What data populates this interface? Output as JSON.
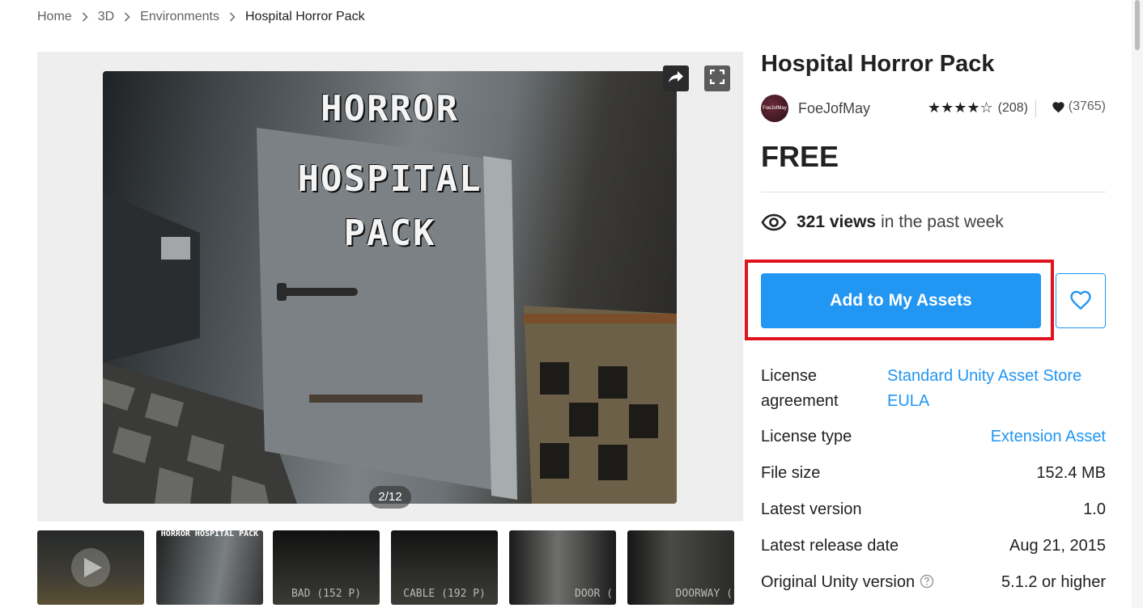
{
  "breadcrumb": {
    "items": [
      "Home",
      "3D",
      "Environments",
      "Hospital Horror Pack"
    ]
  },
  "gallery": {
    "main_title_lines": [
      "HORROR",
      "HOSPITAL",
      "PACK"
    ],
    "counter": "2/12",
    "share_icon": "share-icon",
    "fullscreen_icon": "fullscreen-icon",
    "thumbnails": [
      {
        "label": "",
        "title": "",
        "icon": "play-icon"
      },
      {
        "label": "",
        "title": "HORROR HOSPITAL PACK"
      },
      {
        "label": "BAD (152 P)",
        "title": ""
      },
      {
        "label": "CABLE (192 P)",
        "title": ""
      },
      {
        "label": "DOOR (",
        "title": ""
      },
      {
        "label": "DOORWAY (",
        "title": ""
      }
    ]
  },
  "product": {
    "title": "Hospital Horror Pack",
    "publisher": "FoeJofMay",
    "avatar_text": "FoeJofMay",
    "stars": "★★★★☆",
    "rating_count": "(208)",
    "favorites_count": "(3765)",
    "price": "FREE",
    "views_bold": "321 views",
    "views_rest": "in the past week",
    "add_button": "Add to My Assets"
  },
  "details": {
    "license_label": "License agreement",
    "license_value": "Standard Unity Asset Store EULA",
    "license_type_label": "License type",
    "license_type_value": "Extension Asset",
    "file_size_label": "File size",
    "file_size_value": "152.4 MB",
    "latest_version_label": "Latest version",
    "latest_version_value": "1.0",
    "release_date_label": "Latest release date",
    "release_date_value": "Aug 21, 2015",
    "unity_version_label": "Original Unity version",
    "unity_version_value": "5.1.2 or higher"
  },
  "colors": {
    "accent": "#2196f3",
    "highlight": "#e0141e"
  }
}
